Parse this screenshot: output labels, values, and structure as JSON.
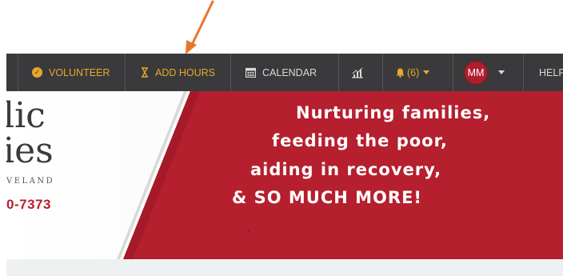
{
  "nav": {
    "volunteer_label": "VOLUNTEER",
    "add_hours_label": "ADD HOURS",
    "calendar_label": "CALENDAR",
    "notifications_label": "(6)",
    "avatar_initials": "MM",
    "help_label": "HELP"
  },
  "logo": {
    "line1": "lic",
    "line2": "ies",
    "line3": "VELAND",
    "phone": "0-7373"
  },
  "hero": {
    "tagline_1": "Nurturing families,",
    "tagline_2": "feeding the poor,",
    "tagline_3": "aiding in recovery,",
    "tagline_4": "& SO MUCH MORE!"
  },
  "colors": {
    "nav_bg": "#3a3a3c",
    "accent": "#e8a82a",
    "hero_red": "#b51f2e",
    "annotation_arrow": "#e8762a"
  },
  "icons": [
    "check-circle-icon",
    "hourglass-icon",
    "calendar-icon",
    "chart-icon",
    "bell-icon",
    "chevron-down-icon"
  ]
}
